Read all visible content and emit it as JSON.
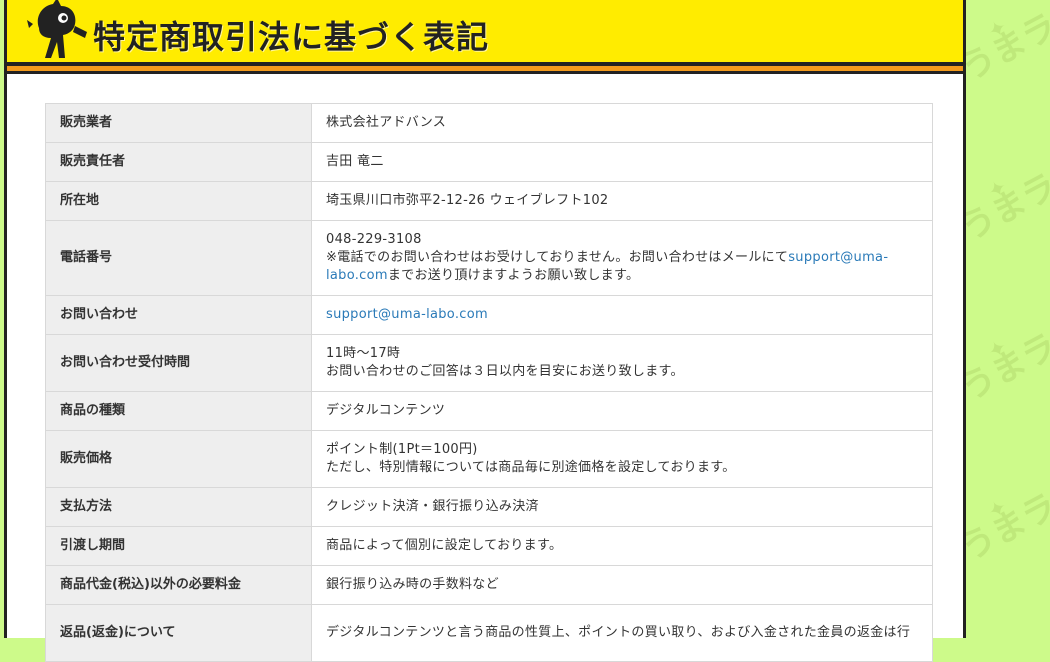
{
  "page": {
    "title": "特定商取引法に基づく表記",
    "background_watermark": "うまラボ",
    "accent_colors": {
      "header_yellow": "#ffec00",
      "stripe_orange": "#f29a1d",
      "background_green": "#cdfa8a",
      "link_blue": "#2a7ab8"
    }
  },
  "rows": [
    {
      "label": "販売業者",
      "lines": [
        "株式会社アドバンス"
      ]
    },
    {
      "label": "販売責任者",
      "lines": [
        "吉田 竜二"
      ]
    },
    {
      "label": "所在地",
      "lines": [
        "埼玉県川口市弥平2-12-26 ウェイブレフト102"
      ]
    },
    {
      "label": "電話番号",
      "lines": [
        "048-229-3108"
      ],
      "note_before_link": "※電話でのお問い合わせはお受けしておりません。お問い合わせはメールにて",
      "note_link": "support@uma-labo.com",
      "note_after_link": "までお送り頂けますようお願い致します。"
    },
    {
      "label": "お問い合わせ",
      "link": "support@uma-labo.com"
    },
    {
      "label": "お問い合わせ受付時間",
      "lines": [
        "11時～17時",
        "お問い合わせのご回答は３日以内を目安にお送り致します。"
      ]
    },
    {
      "label": "商品の種類",
      "lines": [
        "デジタルコンテンツ"
      ]
    },
    {
      "label": "販売価格",
      "lines": [
        "ポイント制(1Pt＝100円)",
        "ただし、特別情報については商品毎に別途価格を設定しております。"
      ]
    },
    {
      "label": "支払方法",
      "lines": [
        "クレジット決済・銀行振り込み決済"
      ]
    },
    {
      "label": "引渡し期間",
      "lines": [
        "商品によって個別に設定しております。"
      ]
    },
    {
      "label": "商品代金(税込)以外の必要料金",
      "lines": [
        "銀行振り込み時の手数料など"
      ]
    },
    {
      "label": "返品(返金)について",
      "lines": [
        "デジタルコンテンツと言う商品の性質上、ポイントの買い取り、および入金された金員の返金は行"
      ]
    }
  ]
}
